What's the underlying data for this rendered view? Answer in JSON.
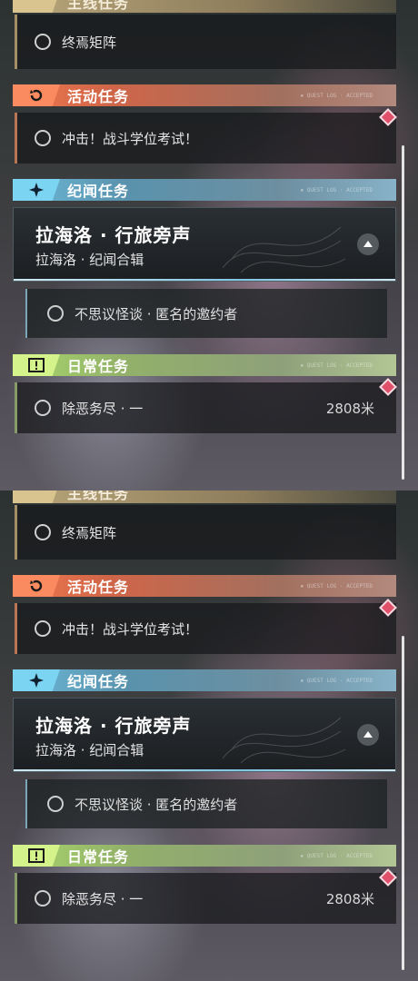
{
  "sections": {
    "main": {
      "title": "主线任务",
      "color": "#b8a57a"
    },
    "activity": {
      "title": "活动任务",
      "color": "#f07a4f"
    },
    "lore": {
      "title": "纪闻任务",
      "color": "#6cbad9"
    },
    "daily": {
      "title": "日常任务",
      "color": "#a8d66b"
    }
  },
  "header_deco": "▪ QUEST LOG · ACCEPTED",
  "main_quest": {
    "name": "终焉矩阵"
  },
  "activity_quest": {
    "name": "冲击！战斗学位考试！"
  },
  "lore_feature": {
    "title": "拉海洛 · 行旅旁声",
    "subtitle": "拉海洛 · 纪闻合辑"
  },
  "lore_quest": {
    "name": "不思议怪谈 · 匿名的邀约者"
  },
  "daily_quest": {
    "name": "除恶务尽 · 一",
    "distance": "2808米"
  },
  "icons": {
    "activity": "refresh-arrow-icon",
    "lore": "sparkle-star-icon",
    "daily": "exclamation-box-icon",
    "track": "triangle-up-icon",
    "marker": "diamond-marker-icon"
  }
}
